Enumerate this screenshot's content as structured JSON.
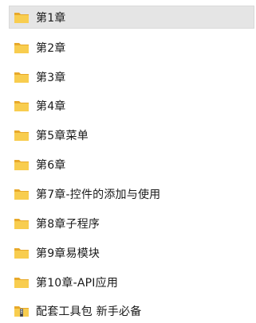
{
  "list": {
    "items": [
      {
        "label": "第1章",
        "icon": "folder-icon",
        "selected": true
      },
      {
        "label": "第2章",
        "icon": "folder-icon",
        "selected": false
      },
      {
        "label": "第3章",
        "icon": "folder-icon",
        "selected": false
      },
      {
        "label": "第4章",
        "icon": "folder-icon",
        "selected": false
      },
      {
        "label": "第5章菜单",
        "icon": "folder-icon",
        "selected": false
      },
      {
        "label": "第6章",
        "icon": "folder-icon",
        "selected": false
      },
      {
        "label": "第7章-控件的添加与使用",
        "icon": "folder-icon",
        "selected": false
      },
      {
        "label": "第8章子程序",
        "icon": "folder-icon",
        "selected": false
      },
      {
        "label": "第9章易模块",
        "icon": "folder-icon",
        "selected": false
      },
      {
        "label": "第10章-API应用",
        "icon": "folder-icon",
        "selected": false
      },
      {
        "label": "配套工具包 新手必备",
        "icon": "zip-folder-icon",
        "selected": false
      }
    ]
  },
  "colors": {
    "folder_back": "#e8a92a",
    "folder_front": "#f8cd4f",
    "selection_bg": "#e5e5e5"
  }
}
